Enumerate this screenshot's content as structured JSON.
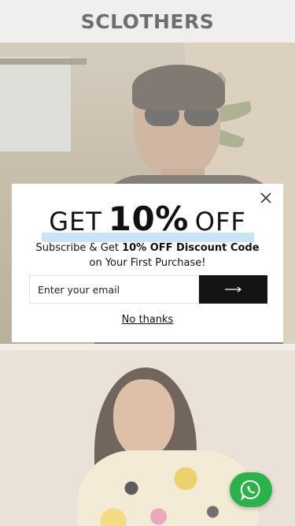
{
  "header": {
    "logo": "SCLOTHERS"
  },
  "popup": {
    "headline_get": "GET",
    "headline_percent": "10%",
    "headline_off": "OFF",
    "subtitle_prefix": "Subscribe & Get ",
    "subtitle_bold": "10% OFF Discount Code",
    "subtitle_line2": "on Your First Purchase!",
    "email_placeholder": "Enter your email",
    "email_value": "",
    "submit_icon": "arrow-right-icon",
    "close_icon": "close-icon",
    "no_thanks": "No thanks"
  },
  "whatsapp": {
    "icon": "whatsapp-icon",
    "color": "#2cb24b"
  },
  "colors": {
    "popup_highlight": "#c9e4f7",
    "button_dark": "#141414"
  }
}
